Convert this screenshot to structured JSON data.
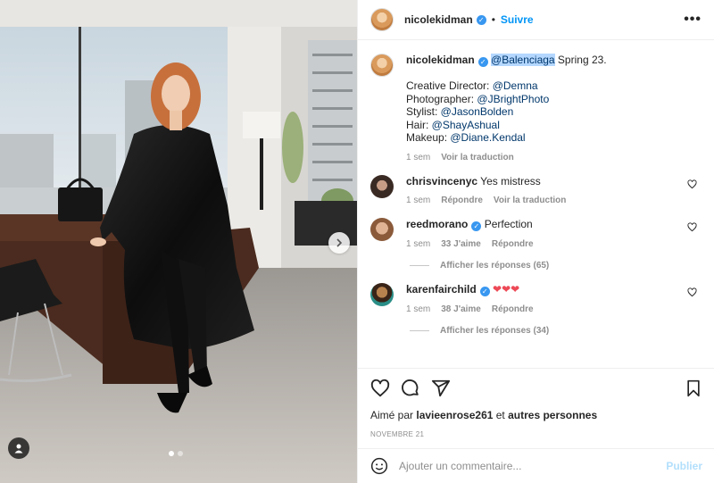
{
  "post": {
    "photo_alt": "Nicole Kidman in black leather coat sitting on desk in office",
    "carousel_total": 2,
    "carousel_active": 1
  },
  "header": {
    "username": "nicolekidman",
    "separator": "•",
    "follow_label": "Suivre",
    "more_label": "•••"
  },
  "caption": {
    "username": "nicolekidman",
    "mention_brand": "@Balenciaga",
    "text_after_brand": " Spring 23.",
    "credits": [
      {
        "label": "Creative Director: ",
        "handle": "@Demna"
      },
      {
        "label": "Photographer: ",
        "handle": "@JBrightPhoto"
      },
      {
        "label": "Stylist: ",
        "handle": "@JasonBolden"
      },
      {
        "label": "Hair: ",
        "handle": "@ShayAshual"
      },
      {
        "label": "Makeup: ",
        "handle": "@Diane.Kendal"
      }
    ],
    "time": "1 sem",
    "translate": "Voir la traduction"
  },
  "comments": [
    {
      "username": "chrisvincenyc",
      "verified": false,
      "text": "Yes mistress",
      "time": "1 sem",
      "likes": "",
      "reply": "Répondre",
      "translate": "Voir la traduction",
      "replies_label": ""
    },
    {
      "username": "reedmorano",
      "verified": true,
      "text": "Perfection",
      "time": "1 sem",
      "likes": "33 J'aime",
      "reply": "Répondre",
      "translate": "",
      "replies_label": "Afficher les réponses (65)"
    },
    {
      "username": "karenfairchild",
      "verified": true,
      "text": "❤❤❤",
      "time": "1 sem",
      "likes": "38 J'aime",
      "reply": "Répondre",
      "translate": "",
      "replies_label": "Afficher les réponses (34)"
    }
  ],
  "likes": {
    "prefix": "Aimé par ",
    "user": "lavieenrose261",
    "middle": " et ",
    "others": "autres personnes"
  },
  "date": "NOVEMBRE 21",
  "add_comment": {
    "placeholder": "Ajouter un commentaire...",
    "post_label": "Publier"
  },
  "colors": {
    "accent": "#0095f6",
    "mention": "#00376b",
    "muted": "#8e8e8e",
    "verified": "#3897f0",
    "heart": "#ed4956"
  }
}
